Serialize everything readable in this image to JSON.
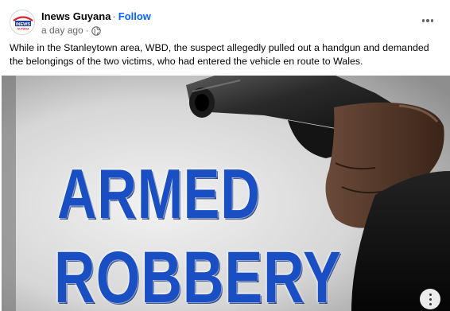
{
  "post": {
    "page_name": "Inews Guyana",
    "separator": "·",
    "follow_label": "Follow",
    "timestamp": "a day ago",
    "meta_separator": "·",
    "privacy_icon": "globe-icon",
    "avatar_text": "iNEWS",
    "avatar_subtext": "GUYANA",
    "caption": "While in the Stanleytown area, WBD, the suspect allegedly pulled out a handgun and demanded the belongings of the two victims, who had entered the vehicle en route to Wales.",
    "more_icon": "more-options-icon"
  },
  "media": {
    "headline_line1": "ARMED",
    "headline_line2": "ROBBERY",
    "more_icon": "media-options-icon"
  },
  "colors": {
    "link_blue": "#0866ff",
    "secondary_text": "#65676b",
    "headline_blue": "#1a4fc4"
  }
}
